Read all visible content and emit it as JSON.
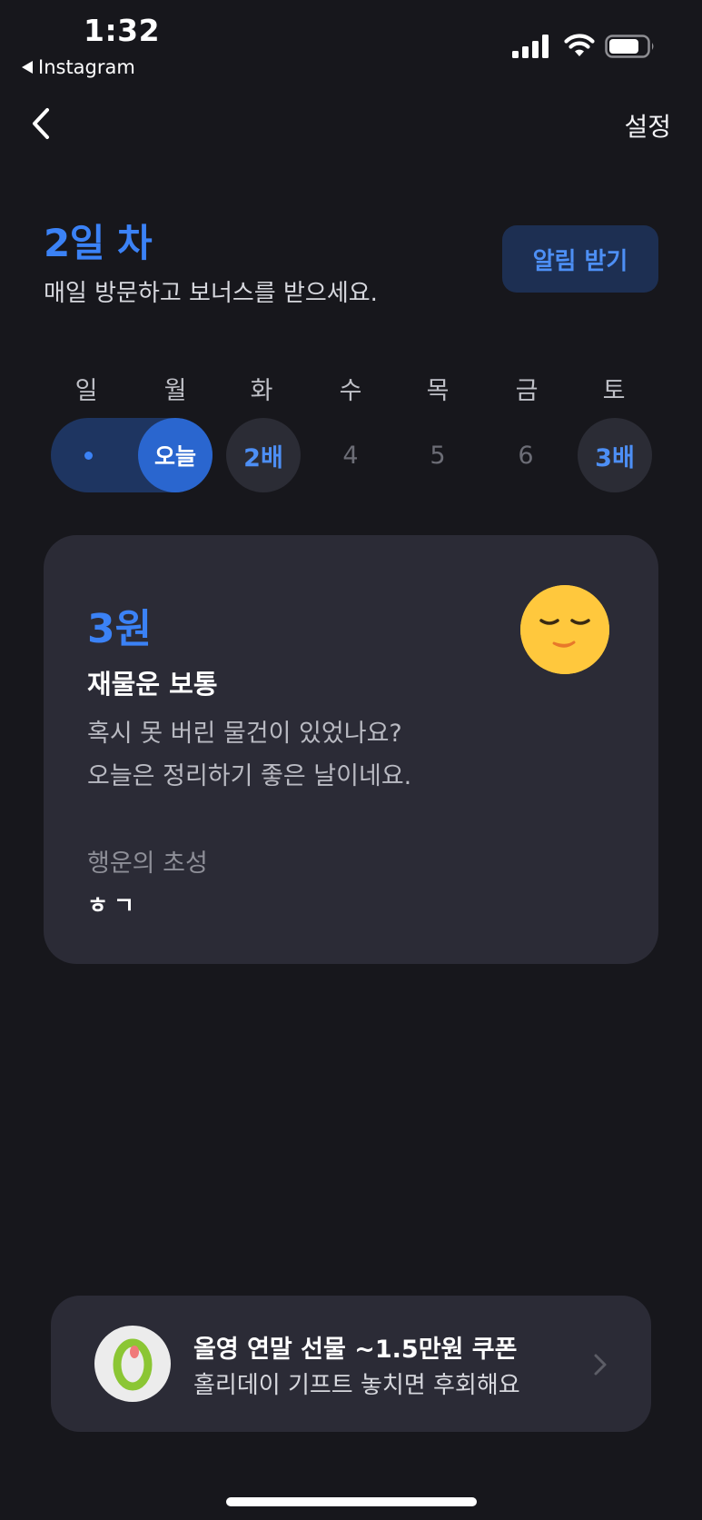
{
  "status_bar": {
    "time": "1:32",
    "back_app": "Instagram"
  },
  "nav": {
    "back_icon": "chevron-left-icon",
    "settings_label": "설정"
  },
  "header": {
    "title": "2일 차",
    "subtitle": "매일 방문하고 보너스를 받으세요.",
    "notify_button": "알림 받기"
  },
  "week": {
    "days": [
      "일",
      "월",
      "화",
      "수",
      "목",
      "금",
      "토"
    ],
    "today_label": "오늘",
    "bonus_tue": "2배",
    "num_wed": "4",
    "num_thu": "5",
    "num_fri": "6",
    "bonus_sat": "3배",
    "completed_days": 1
  },
  "fortune": {
    "amount": "3원",
    "title": "재물운 보통",
    "line1": "혹시 못 버린 물건이 있었나요?",
    "line2": "오늘은 정리하기 좋은 날이네요.",
    "lucky_label": "행운의 초성",
    "lucky_value": "ㅎㄱ",
    "face_icon": "relieved-face-icon"
  },
  "promo": {
    "title": "올영 연말 선물 ~1.5만원 쿠폰",
    "subtitle": "홀리데이 기프트 놓치면 후회해요",
    "logo_icon": "oliveyoung-logo-icon",
    "chevron_icon": "chevron-right-icon"
  },
  "colors": {
    "background": "#17171c",
    "card": "#2b2b36",
    "accent": "#3b82f6",
    "notify_bg": "#1d2f52"
  }
}
